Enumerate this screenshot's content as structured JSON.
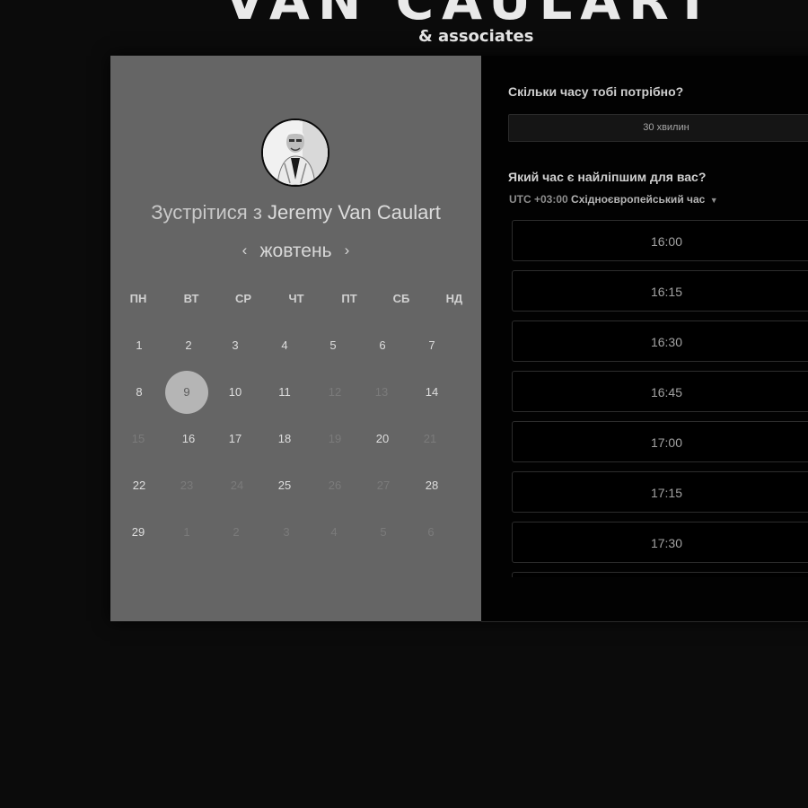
{
  "brand": {
    "main": "VAN CAULART",
    "sub": "& associates"
  },
  "scheduler": {
    "meet_prefix": "Зустрітися з",
    "host_name": "Jeremy Van Caulart",
    "month": "жовтень",
    "prev_month_icon": "chevron-left-icon",
    "next_month_icon": "chevron-right-icon",
    "weekdays": [
      "ПН",
      "ВТ",
      "СР",
      "ЧТ",
      "ПТ",
      "СБ",
      "НД"
    ],
    "days": [
      [
        "1",
        "2",
        "3",
        "4",
        "5",
        "6",
        "7"
      ],
      [
        "8",
        "9",
        "10",
        "11",
        "12",
        "13",
        "14"
      ],
      [
        "15",
        "16",
        "17",
        "18",
        "19",
        "20",
        "21"
      ],
      [
        "22",
        "23",
        "24",
        "25",
        "26",
        "27",
        "28"
      ],
      [
        "29",
        "1",
        "2",
        "3",
        "4",
        "5",
        "6"
      ]
    ],
    "selected_day": "9"
  },
  "booking": {
    "duration_question": "Скільки часу тобі потрібно?",
    "duration_value": "30 хвилин",
    "time_question": "Який час є найліпшим для вас?",
    "timezone_offset": "UTC +03:00",
    "timezone_name": "Східноєвропейський час",
    "timezone_icon": "caret-down-icon",
    "slots": [
      "16:00",
      "16:15",
      "16:30",
      "16:45",
      "17:00",
      "17:15",
      "17:30"
    ]
  },
  "colors": {
    "page_background": "#0b0b0b",
    "calendar_panel": "#656565",
    "selected_day": "#b5b5b5",
    "slot_border": "#2c2c2c"
  }
}
